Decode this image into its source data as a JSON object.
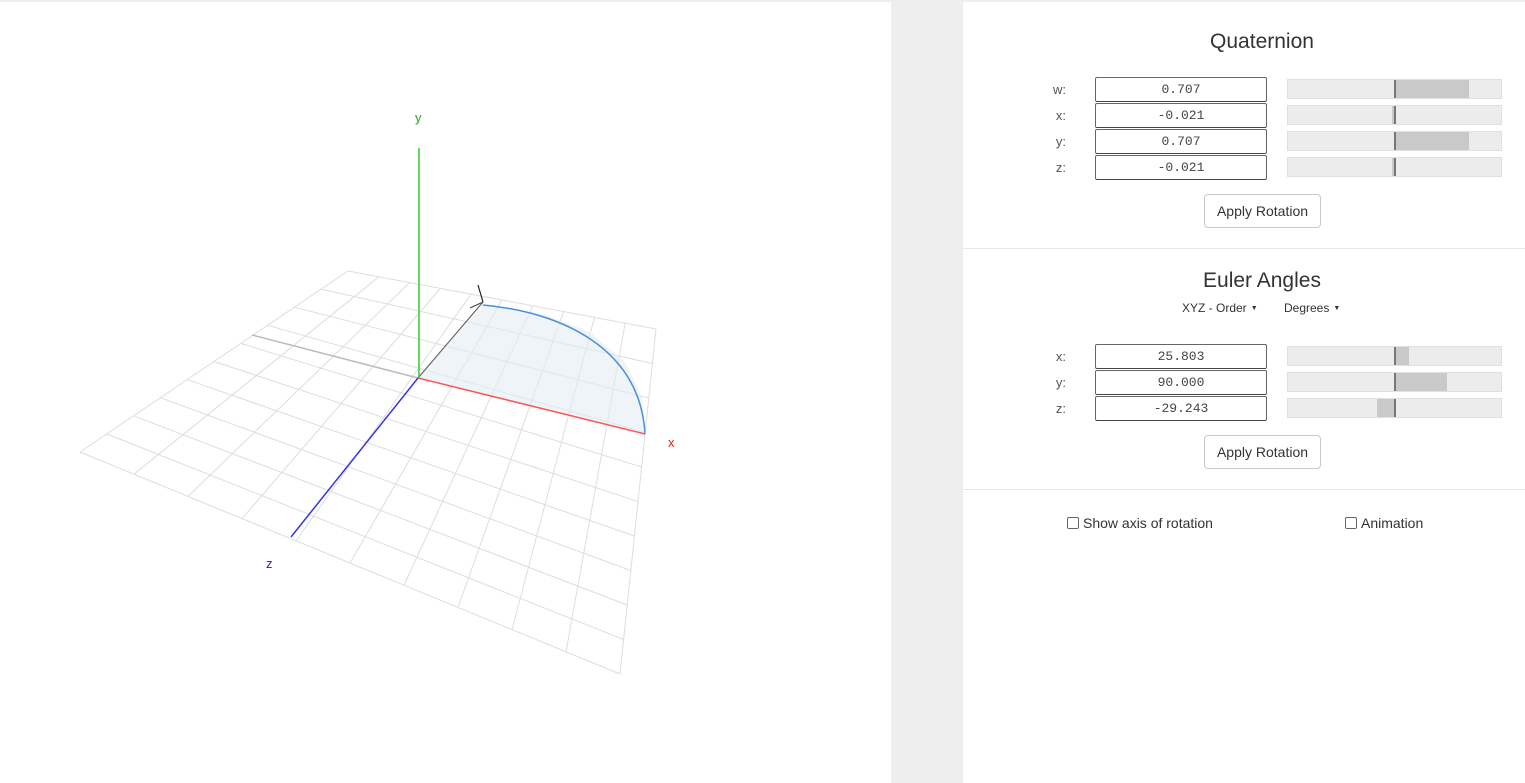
{
  "colors": {
    "x_axis": "#ff5555",
    "y_axis": "#33cc33",
    "z_axis": "#3333ee",
    "arc": "#4a90d9",
    "grid": "#dddddd"
  },
  "viewport": {
    "axis_labels": {
      "x": "x",
      "y": "y",
      "z": "z"
    }
  },
  "quaternion": {
    "title": "Quaternion",
    "rows": [
      {
        "label": "w:",
        "value": "0.707",
        "level": 0.707
      },
      {
        "label": "x:",
        "value": "-0.021",
        "level": -0.021
      },
      {
        "label": "y:",
        "value": "0.707",
        "level": 0.707
      },
      {
        "label": "z:",
        "value": "-0.021",
        "level": -0.021
      }
    ],
    "apply_label": "Apply Rotation"
  },
  "euler": {
    "title": "Euler Angles",
    "order_label": "XYZ - Order",
    "units_label": "Degrees",
    "rows": [
      {
        "label": "x:",
        "value": "25.803",
        "level": 0.143
      },
      {
        "label": "y:",
        "value": "90.000",
        "level": 0.5
      },
      {
        "label": "z:",
        "value": "-29.243",
        "level": -0.162
      }
    ],
    "apply_label": "Apply Rotation"
  },
  "options": {
    "show_axis_label": "Show axis of rotation",
    "show_axis_checked": false,
    "animation_label": "Animation",
    "animation_checked": false
  }
}
